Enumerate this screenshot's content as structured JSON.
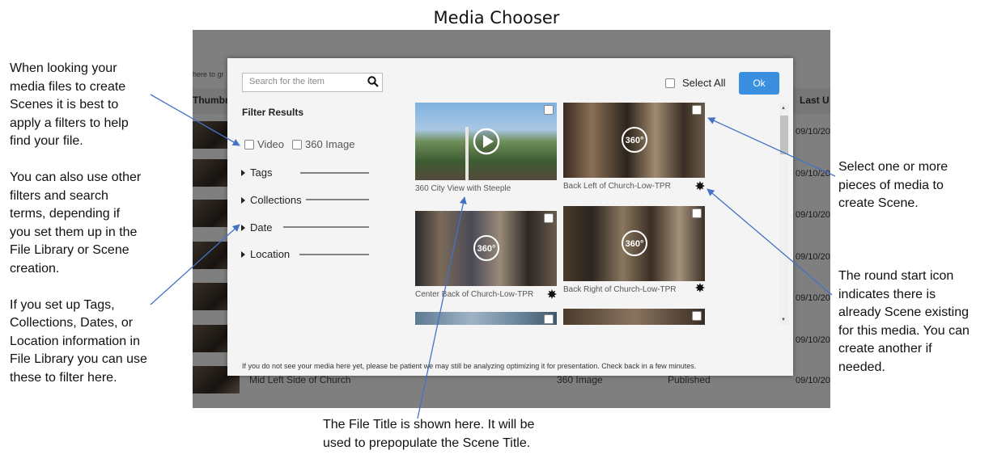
{
  "page_title": "Media Chooser",
  "background_app": {
    "hint_text": "here to gr",
    "col_thumbnail": "Thumbn",
    "col_last": "Last U",
    "dates": [
      "09/10/20",
      "09/10/20",
      "09/10/20",
      "09/10/20",
      "09/10/20",
      "09/10/20",
      "09/10/20"
    ],
    "row": {
      "name": "Mid Left Side of Church",
      "type": "360 Image",
      "status": "Published"
    }
  },
  "modal": {
    "search_placeholder": "Search for the item",
    "select_all_label": "Select All",
    "ok_label": "Ok",
    "filter_heading": "Filter Results",
    "type_filters": [
      "Video",
      "360 Image"
    ],
    "filter_groups": [
      "Tags",
      "Collections",
      "Date",
      "Location"
    ],
    "media": [
      {
        "title": "360 City View with Steeple",
        "kind": "video",
        "has_scene": false
      },
      {
        "title": "Back Left of Church-Low-TPR",
        "kind": "360",
        "has_scene": true
      },
      {
        "title": "Center Back of Church-Low-TPR",
        "kind": "360",
        "has_scene": true
      },
      {
        "title": "Back Right of Church-Low-TPR",
        "kind": "360",
        "has_scene": true
      },
      {
        "title": "",
        "kind": "partial",
        "has_scene": false
      },
      {
        "title": "",
        "kind": "partial",
        "has_scene": false
      }
    ],
    "footer_note": "If you do not see your media here yet, please be patient we may still be analyzing optimizing it for presentation. Check back in a few minutes."
  },
  "annotations": {
    "left": [
      "When looking your",
      "media files to create",
      "Scenes it is best to",
      "apply a filters to help",
      "find your file.",
      "",
      "You can also use other",
      "filters and search",
      "terms, depending if",
      "you set them up in the",
      "File Library or Scene",
      "creation.",
      "",
      "If you set up Tags,",
      "Collections, Dates, or",
      "Location information in",
      "File Library you can use",
      "these to filter here."
    ],
    "right_select": [
      "Select one or more",
      "pieces of media to",
      "create Scene."
    ],
    "right_scene": [
      "The round start icon",
      "indicates there is",
      "already Scene existing",
      "for this media.  You can",
      "create another if",
      "needed."
    ],
    "bottom": [
      "The File Title is shown here.  It will be",
      "used to prepopulate the Scene Title."
    ]
  },
  "colors": {
    "accent": "#3a8fe0",
    "arrow": "#4472c4",
    "overlay": "rgba(0,0,0,0.48)"
  },
  "icons": [
    "search-icon",
    "play-icon",
    "360-icon",
    "scene-starburst-icon",
    "chevron-right-icon"
  ]
}
